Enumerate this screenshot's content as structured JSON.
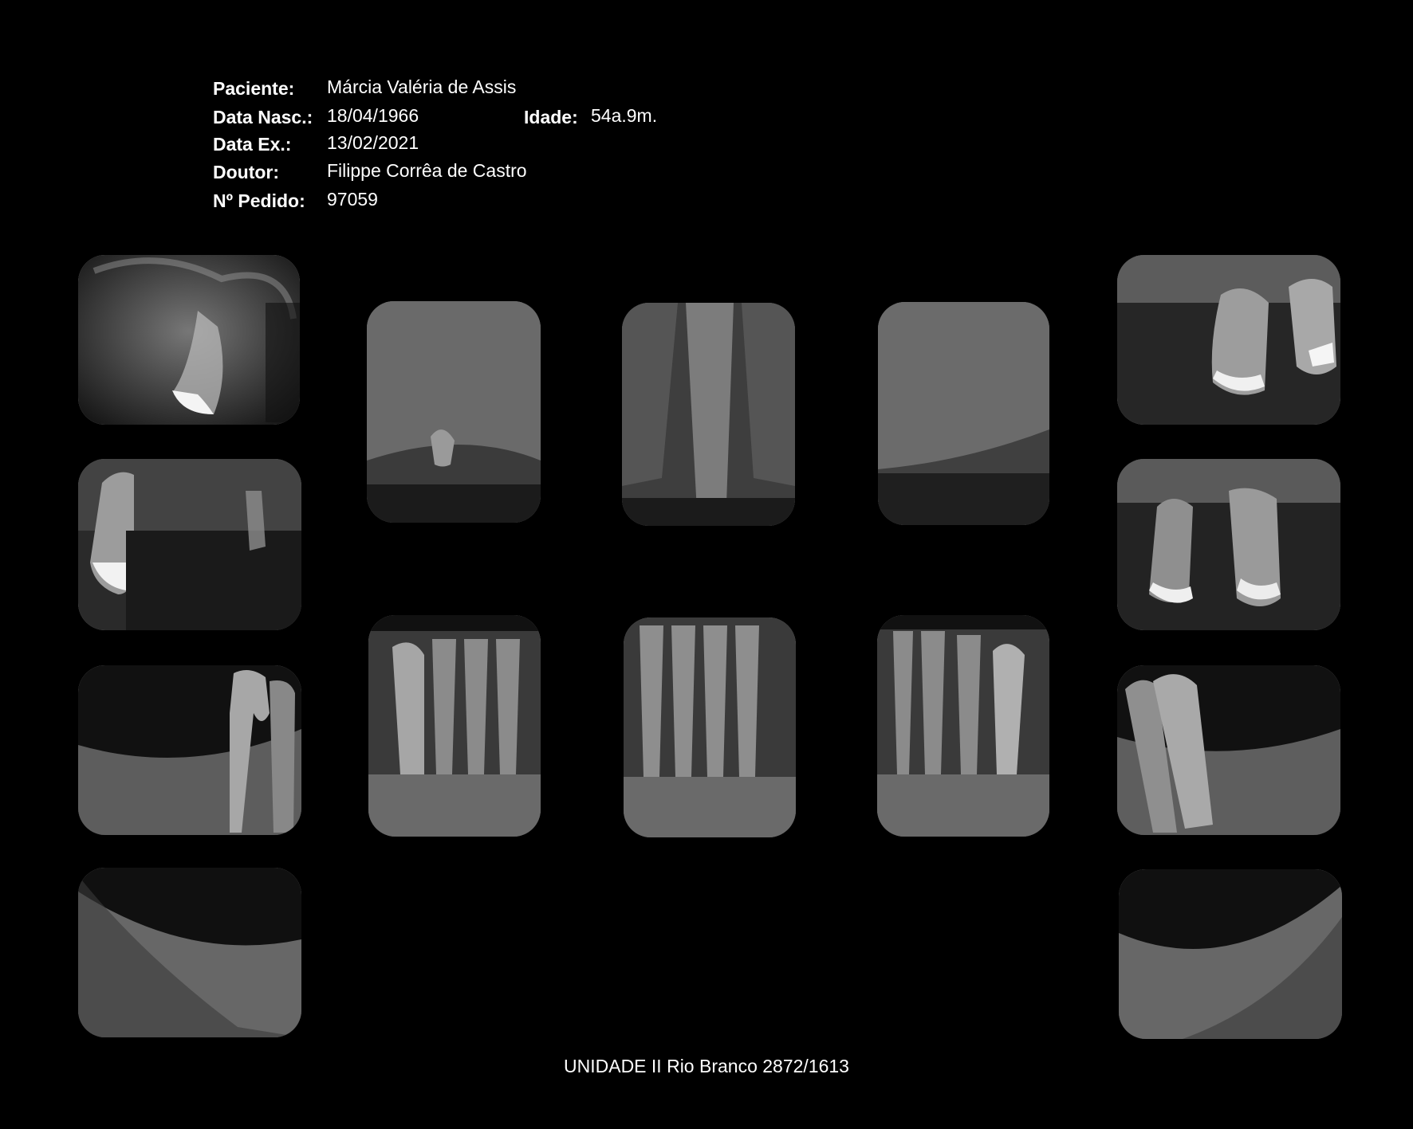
{
  "patient_info": {
    "labels": {
      "patient": "Paciente:",
      "birth_date": "Data Nasc.:",
      "age": "Idade:",
      "exam_date": "Data Ex.:",
      "doctor": "Doutor:",
      "order_number": "Nº Pedido:"
    },
    "values": {
      "patient": "Márcia Valéria de Assis",
      "birth_date": "18/04/1966",
      "age": "54a.9m.",
      "exam_date": "13/02/2021",
      "doctor": "Filippe Corrêa de Castro",
      "order_number": "97059"
    }
  },
  "footer": "UNIDADE II Rio Branco 2872/1613",
  "radiographs": [
    {
      "id": "upper-right-molar",
      "region": "upper",
      "content": "molar-with-fillings"
    },
    {
      "id": "upper-right-premolar",
      "region": "upper",
      "content": "premolar-with-fillings"
    },
    {
      "id": "upper-right-canine",
      "region": "upper",
      "content": "sinus-bone"
    },
    {
      "id": "upper-incisors",
      "region": "upper",
      "content": "incisors-bone"
    },
    {
      "id": "upper-left-canine",
      "region": "upper",
      "content": "sinus-bone"
    },
    {
      "id": "upper-left-molar",
      "region": "upper",
      "content": "molar-with-fillings"
    },
    {
      "id": "upper-left-premolar",
      "region": "upper",
      "content": "premolar-with-fillings"
    },
    {
      "id": "lower-right-molar",
      "region": "lower",
      "content": "lower-molar"
    },
    {
      "id": "lower-right-canine",
      "region": "lower",
      "content": "lower-anterior"
    },
    {
      "id": "lower-incisors",
      "region": "lower",
      "content": "lower-anterior"
    },
    {
      "id": "lower-left-canine",
      "region": "lower",
      "content": "lower-anterior"
    },
    {
      "id": "lower-left-molar",
      "region": "lower",
      "content": "lower-molar"
    },
    {
      "id": "lower-right-ramus",
      "region": "lower",
      "content": "mandible-bone"
    },
    {
      "id": "lower-left-ramus",
      "region": "lower",
      "content": "mandible-bone"
    }
  ]
}
